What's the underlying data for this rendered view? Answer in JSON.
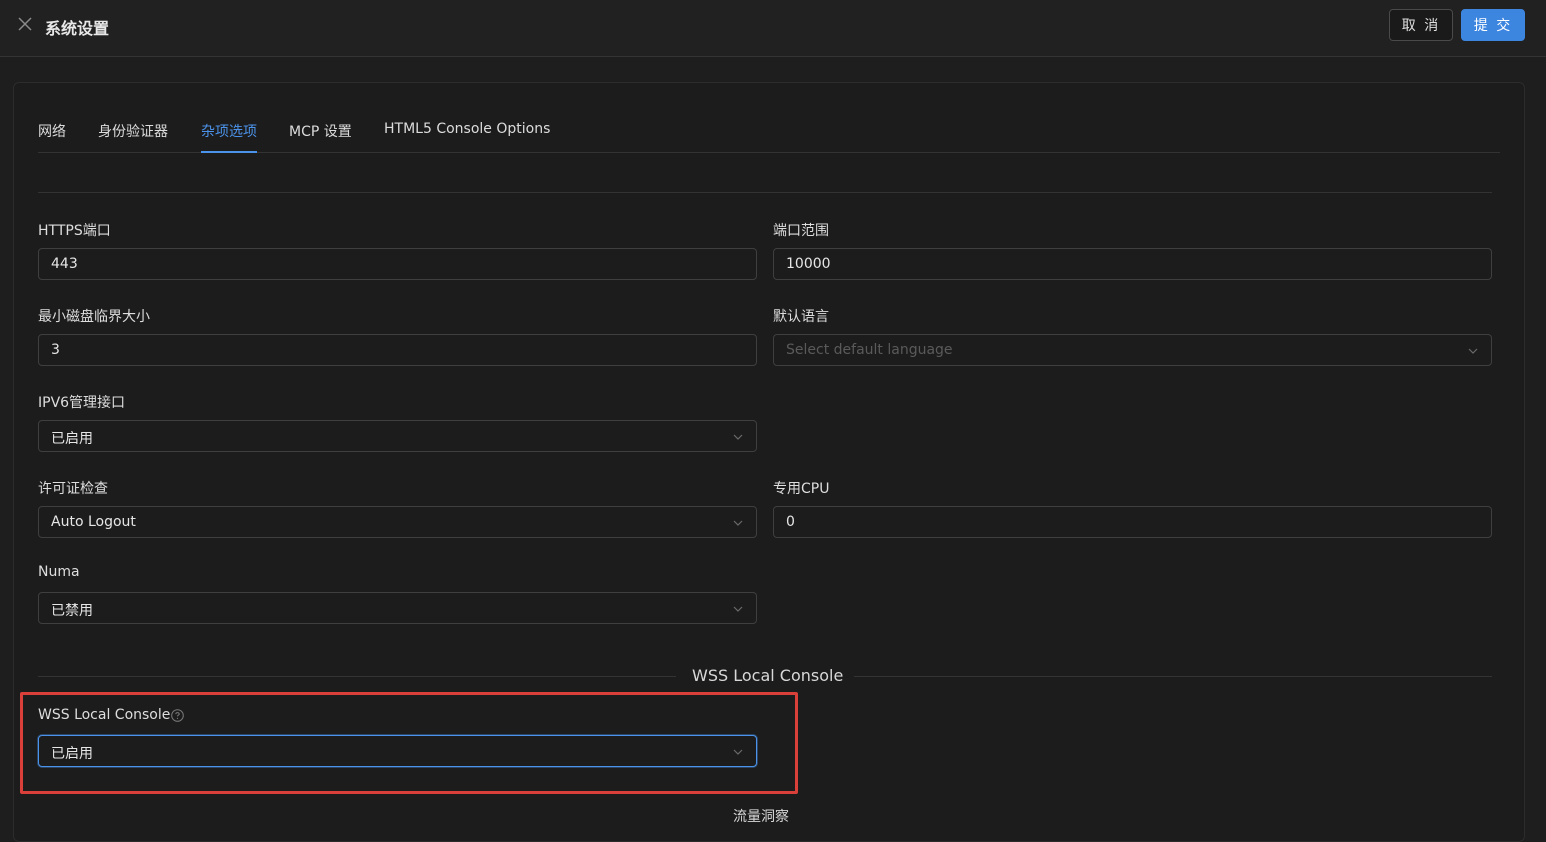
{
  "header": {
    "title": "系统设置",
    "cancel_label": "取 消",
    "submit_label": "提 交",
    "close_icon": "close-icon"
  },
  "tabs": [
    {
      "label": "网络"
    },
    {
      "label": "身份验证器"
    },
    {
      "label": "杂项选项",
      "active": true
    },
    {
      "label": "MCP 设置"
    },
    {
      "label": "HTML5 Console Options"
    }
  ],
  "form": {
    "https_port": {
      "label": "HTTPS端口",
      "value": "443"
    },
    "port_range": {
      "label": "端口范围",
      "value": "10000"
    },
    "min_disk": {
      "label": "最小磁盘临界大小",
      "value": "3"
    },
    "default_language": {
      "label": "默认语言",
      "placeholder": "Select default language"
    },
    "ipv6_mgmt": {
      "label": "IPV6管理接口",
      "value": "已启用"
    },
    "license_check": {
      "label": "许可证检查",
      "value": "Auto Logout"
    },
    "dedicated_cpu": {
      "label": "专用CPU",
      "value": "0"
    },
    "numa": {
      "label": "Numa",
      "value": "已禁用"
    }
  },
  "wss_section": {
    "divider_title": "WSS Local Console",
    "field_label": "WSS Local Console",
    "value": "已启用",
    "help_icon": "help-circle-icon"
  },
  "next_section_partial": "流量洞察",
  "colors": {
    "accent": "#3d86e0",
    "highlight": "#d9403a",
    "background": "#1e1e1e"
  }
}
